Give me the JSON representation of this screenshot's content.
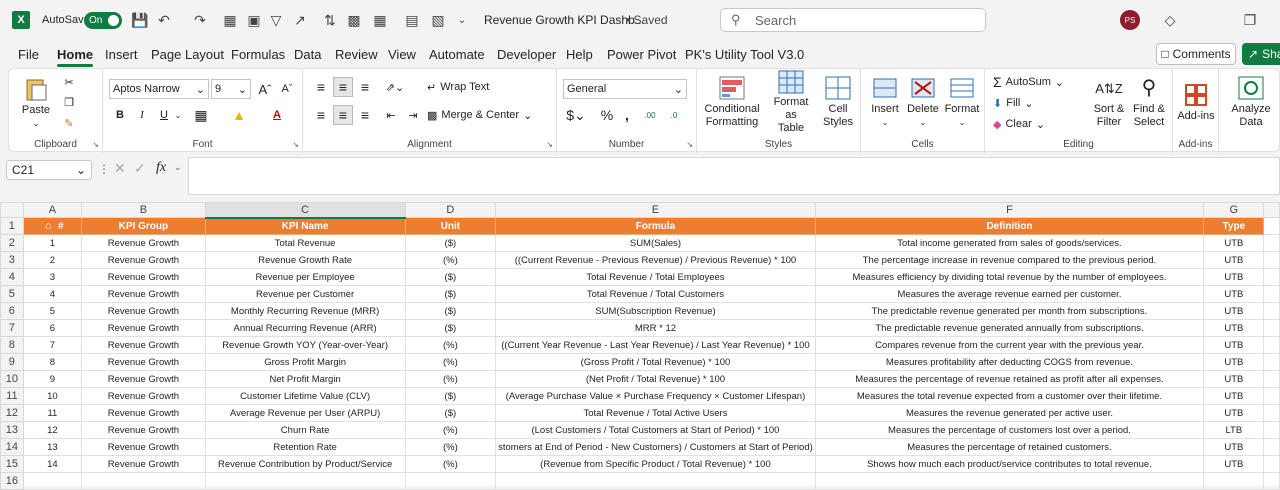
{
  "titlebar": {
    "autosave_label": "AutoSave",
    "toggle_label": "On",
    "doc_title": "Revenue Growth KPI Dashb...",
    "saved_label": "• Saved",
    "search_placeholder": "Search",
    "avatar_initials": "PS"
  },
  "menu": {
    "items": [
      "File",
      "Home",
      "Insert",
      "Page Layout",
      "Formulas",
      "Data",
      "Review",
      "View",
      "Automate",
      "Developer",
      "Help",
      "Power Pivot",
      "PK's Utility Tool V3.0"
    ],
    "active": "Home",
    "comments_label": "Comments",
    "share_label": "Sha"
  },
  "ribbon": {
    "clipboard": {
      "paste": "Paste",
      "label": "Clipboard"
    },
    "font": {
      "name": "Aptos Narrow",
      "size": "9",
      "label": "Font"
    },
    "alignment": {
      "wrap": "Wrap Text",
      "merge": "Merge & Center",
      "label": "Alignment"
    },
    "number": {
      "format": "General",
      "label": "Number"
    },
    "styles": {
      "cond1": "Conditional",
      "cond2": "Formatting",
      "fmt1": "Format as",
      "fmt2": "Table",
      "cell1": "Cell",
      "cell2": "Styles",
      "label": "Styles"
    },
    "cells": {
      "insert": "Insert",
      "delete": "Delete",
      "format": "Format",
      "label": "Cells"
    },
    "editing": {
      "autosum": "AutoSum",
      "fill": "Fill",
      "clear": "Clear",
      "sort1": "Sort &",
      "sort2": "Filter",
      "find1": "Find &",
      "find2": "Select",
      "label": "Editing"
    },
    "addins": {
      "addins": "Add-ins",
      "label": "Add-ins",
      "analyze1": "Analyze",
      "analyze2": "Data"
    }
  },
  "formula_bar": {
    "cell_ref": "C21",
    "fx": "fx",
    "content": ""
  },
  "sheet": {
    "columns": [
      "A",
      "B",
      "C",
      "D",
      "E",
      "F",
      "G"
    ],
    "header": {
      "a": "#",
      "b": "KPI Group",
      "c": "KPI Name",
      "d": "Unit",
      "e": "Formula",
      "f": "Definition",
      "g": "Type"
    },
    "rows": [
      {
        "n": "1",
        "group": "Revenue Growth",
        "name": "Total Revenue",
        "unit": "($)",
        "formula": "SUM(Sales)",
        "definition": "Total income generated from sales of goods/services.",
        "type": "UTB"
      },
      {
        "n": "2",
        "group": "Revenue Growth",
        "name": "Revenue Growth Rate",
        "unit": "(%)",
        "formula": "((Current Revenue - Previous Revenue) / Previous Revenue) * 100",
        "definition": "The percentage increase in revenue compared to the previous period.",
        "type": "UTB"
      },
      {
        "n": "3",
        "group": "Revenue Growth",
        "name": "Revenue per Employee",
        "unit": "($)",
        "formula": "Total Revenue / Total Employees",
        "definition": "Measures efficiency by dividing total revenue by the number of employees.",
        "type": "UTB"
      },
      {
        "n": "4",
        "group": "Revenue Growth",
        "name": "Revenue per Customer",
        "unit": "($)",
        "formula": "Total Revenue / Total Customers",
        "definition": "Measures the average revenue earned per customer.",
        "type": "UTB"
      },
      {
        "n": "5",
        "group": "Revenue Growth",
        "name": "Monthly Recurring Revenue (MRR)",
        "unit": "($)",
        "formula": "SUM(Subscription Revenue)",
        "definition": "The predictable revenue generated per month from subscriptions.",
        "type": "UTB"
      },
      {
        "n": "6",
        "group": "Revenue Growth",
        "name": "Annual Recurring Revenue (ARR)",
        "unit": "($)",
        "formula": "MRR * 12",
        "definition": "The predictable revenue generated annually from subscriptions.",
        "type": "UTB"
      },
      {
        "n": "7",
        "group": "Revenue Growth",
        "name": "Revenue Growth YOY (Year-over-Year)",
        "unit": "(%)",
        "formula": "((Current Year Revenue - Last Year Revenue) / Last Year Revenue) * 100",
        "definition": "Compares revenue from the current year with the previous year.",
        "type": "UTB"
      },
      {
        "n": "8",
        "group": "Revenue Growth",
        "name": "Gross Profit Margin",
        "unit": "(%)",
        "formula": "(Gross Profit / Total Revenue) * 100",
        "definition": "Measures profitability after deducting COGS from revenue.",
        "type": "UTB"
      },
      {
        "n": "9",
        "group": "Revenue Growth",
        "name": "Net Profit Margin",
        "unit": "(%)",
        "formula": "(Net Profit / Total Revenue) * 100",
        "definition": "Measures the percentage of revenue retained as profit after all expenses.",
        "type": "UTB"
      },
      {
        "n": "10",
        "group": "Revenue Growth",
        "name": "Customer Lifetime Value (CLV)",
        "unit": "($)",
        "formula": "(Average Purchase Value × Purchase Frequency × Customer Lifespan)",
        "definition": "Measures the total revenue expected from a customer over their lifetime.",
        "type": "UTB"
      },
      {
        "n": "11",
        "group": "Revenue Growth",
        "name": "Average Revenue per User (ARPU)",
        "unit": "($)",
        "formula": "Total Revenue / Total Active Users",
        "definition": "Measures the revenue generated per active user.",
        "type": "UTB"
      },
      {
        "n": "12",
        "group": "Revenue Growth",
        "name": "Churn Rate",
        "unit": "(%)",
        "formula": "(Lost Customers / Total Customers at Start of Period) * 100",
        "definition": "Measures the percentage of customers lost over a period.",
        "type": "LTB"
      },
      {
        "n": "13",
        "group": "Revenue Growth",
        "name": "Retention Rate",
        "unit": "(%)",
        "formula": "stomers at End of Period - New Customers) / Customers at Start of Period)",
        "definition": "Measures the percentage of retained customers.",
        "type": "UTB"
      },
      {
        "n": "14",
        "group": "Revenue Growth",
        "name": "Revenue Contribution by Product/Service",
        "unit": "(%)",
        "formula": "(Revenue from Specific Product / Total Revenue) * 100",
        "definition": "Shows how much each product/service contributes to total revenue.",
        "type": "UTB"
      }
    ]
  }
}
